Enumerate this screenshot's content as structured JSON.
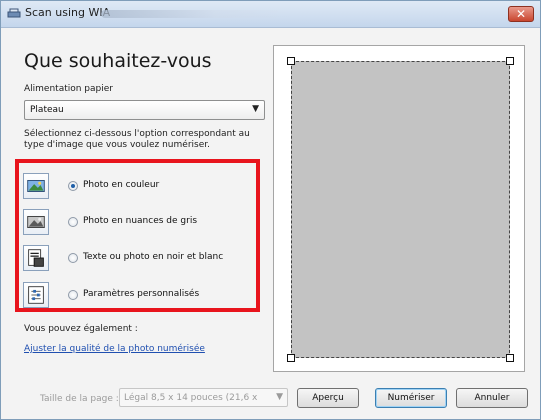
{
  "window": {
    "title": "Scan using WIA",
    "close_glyph": "✕"
  },
  "panel": {
    "heading": "Que souhaitez-vous",
    "paper_feed_label": "Alimentation papier",
    "paper_feed_value": "Plateau",
    "instruction": "Sélectionnez ci-dessous l'option correspondant au type d'image que vous voulez numériser.",
    "options": [
      {
        "label": "Photo en couleur",
        "icon": "color-photo-icon",
        "selected": true
      },
      {
        "label": "Photo en nuances de gris",
        "icon": "grayscale-photo-icon",
        "selected": false
      },
      {
        "label": "Texte ou photo en noir et blanc",
        "icon": "black-white-text-icon",
        "selected": false
      },
      {
        "label": "Paramètres personnalisés",
        "icon": "custom-settings-icon",
        "selected": false
      }
    ],
    "also_label": "Vous pouvez également :",
    "adjust_link": "Ajuster la qualité de la photo numérisée"
  },
  "footer": {
    "page_size_label": "Taille de la page :",
    "page_size_value": "Légal 8,5 x 14 pouces (21,6 x",
    "preview_button": "Aperçu",
    "scan_button": "Numériser",
    "cancel_button": "Annuler"
  },
  "colors": {
    "highlight_border": "#e8141d",
    "link": "#1f4fb0",
    "preview_page": "#c3c3c3"
  }
}
